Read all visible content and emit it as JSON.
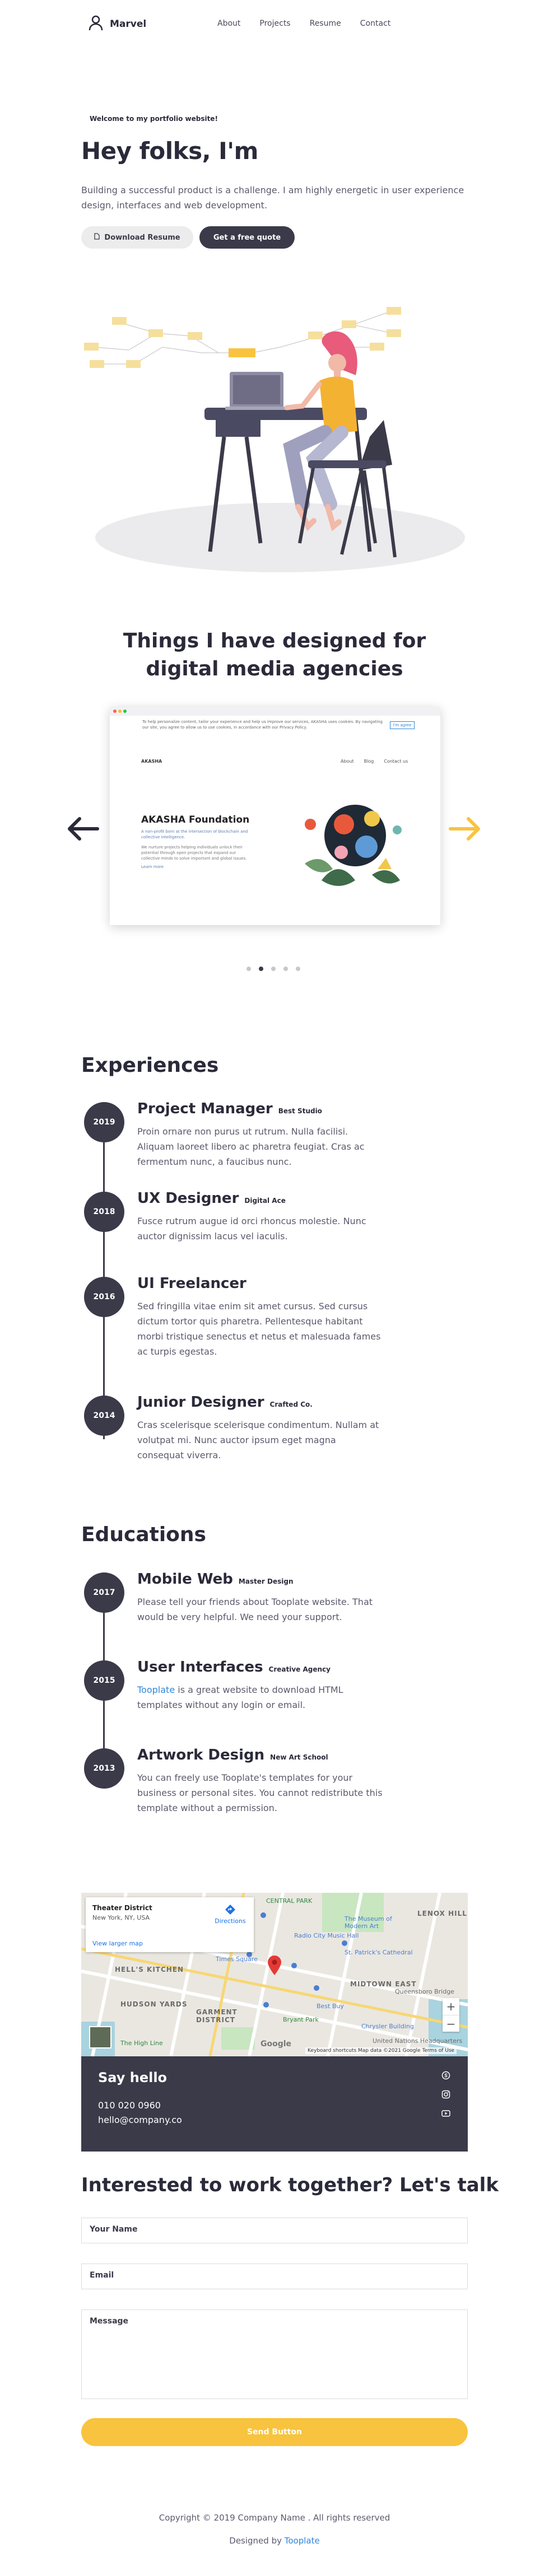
{
  "brand": {
    "name": "Marvel"
  },
  "nav": [
    {
      "label": "About"
    },
    {
      "label": "Projects"
    },
    {
      "label": "Resume"
    },
    {
      "label": "Contact"
    }
  ],
  "hero": {
    "welcome": "Welcome to my portfolio website!",
    "title": "Hey folks, I'm",
    "text": "Building a successful product is a challenge. I am highly energetic in user experience design, interfaces and web development.",
    "download_label": "Download Resume",
    "quote_label": "Get a free quote"
  },
  "portfolio": {
    "title": "Things I have designed for digital media agencies",
    "slide": {
      "cookie_text": "To help personalize content, tailor your experience and help us improve our services, AKASHA uses cookies. By navigating our site, you agree to allow us to use cookies, in accordance with our Privacy Policy.",
      "cookie_button": "I'm agree",
      "site_logo": "AKASHA",
      "site_nav": [
        "About",
        "Blog",
        "Contact us"
      ],
      "heading": "AKASHA Foundation",
      "subheading": "A non-profit born at the intersection of blockchain and collective intelligence.",
      "body": "We nurture projects helping individuals unlock their potential through open projects that expand our collective minds to solve important and global issues.",
      "link": "Learn more"
    },
    "dots": 5,
    "active_dot": 1
  },
  "experiences": {
    "title": "Experiences",
    "items": [
      {
        "year": "2019",
        "title": "Project Manager",
        "org": "Best Studio",
        "text": "Proin ornare non purus ut rutrum. Nulla facilisi. Aliquam laoreet libero ac pharetra feugiat. Cras ac fermentum nunc, a faucibus nunc."
      },
      {
        "year": "2018",
        "title": "UX Designer",
        "org": "Digital Ace",
        "text": "Fusce rutrum augue id orci rhoncus molestie. Nunc auctor dignissim lacus vel iaculis."
      },
      {
        "year": "2016",
        "title": "UI Freelancer",
        "org": "",
        "text": "Sed fringilla vitae enim sit amet cursus. Sed cursus dictum tortor quis pharetra. Pellentesque habitant morbi tristique senectus et netus et malesuada fames ac turpis egestas."
      },
      {
        "year": "2014",
        "title": "Junior Designer",
        "org": "Crafted Co.",
        "text": "Cras scelerisque scelerisque condimentum. Nullam at volutpat mi. Nunc auctor ipsum eget magna consequat viverra."
      }
    ]
  },
  "educations": {
    "title": "Educations",
    "items": [
      {
        "year": "2017",
        "title": "Mobile Web",
        "org": "Master Design",
        "text": "Please tell your friends about Tooplate website. That would be very helpful. We need your support."
      },
      {
        "year": "2015",
        "title": "User Interfaces",
        "org": "Creative Agency",
        "link": "Tooplate",
        "text": " is a great website to download HTML templates without any login or email."
      },
      {
        "year": "2013",
        "title": "Artwork Design",
        "org": "New Art School",
        "text": "You can freely use Tooplate's templates for your business or personal sites. You cannot redistribute this template without a permission."
      }
    ]
  },
  "map": {
    "place": "Theater District",
    "city": "New York, NY, USA",
    "directions": "Directions",
    "larger": "View larger map",
    "labels": [
      "Radio City Music Hall",
      "Times Square",
      "The Museum of Modern Art",
      "St. Patrick's Cathedral",
      "MIDTOWN EAST",
      "LENOX HILL",
      "HELL'S KITCHEN",
      "HUDSON YARDS",
      "GARMENT DISTRICT",
      "Bryant Park",
      "Best Buy",
      "Chrysler Building",
      "Queensboro Bridge",
      "United Nations Headquarters",
      "The High Line",
      "CENTRAL PARK"
    ],
    "footer": "Keyboard shortcuts   Map data ©2021 Google   Terms of Use",
    "brand": "Google"
  },
  "contact": {
    "title": "Say hello",
    "phone": "010 020 0960",
    "email": "hello@company.co"
  },
  "form": {
    "title": "Interested to work together? Let's talk",
    "name_label": "Your Name",
    "email_label": "Email",
    "message_label": "Message",
    "send_label": "Send Button"
  },
  "footer": {
    "copyright": "Copyright © 2019 Company Name . All rights reserved",
    "designed_by": "Designed by ",
    "designer": "Tooplate"
  },
  "colors": {
    "dark": "#3b3a49",
    "accent": "#f8c33e",
    "link": "#2f86d8",
    "light_btn": "#ececed"
  },
  "icons": [
    "user-icon",
    "document-icon",
    "arrow-left-icon",
    "arrow-right-icon",
    "skype-icon",
    "instagram-icon",
    "youtube-icon",
    "map-pin-icon",
    "directions-icon",
    "zoom-in-icon",
    "zoom-out-icon"
  ]
}
